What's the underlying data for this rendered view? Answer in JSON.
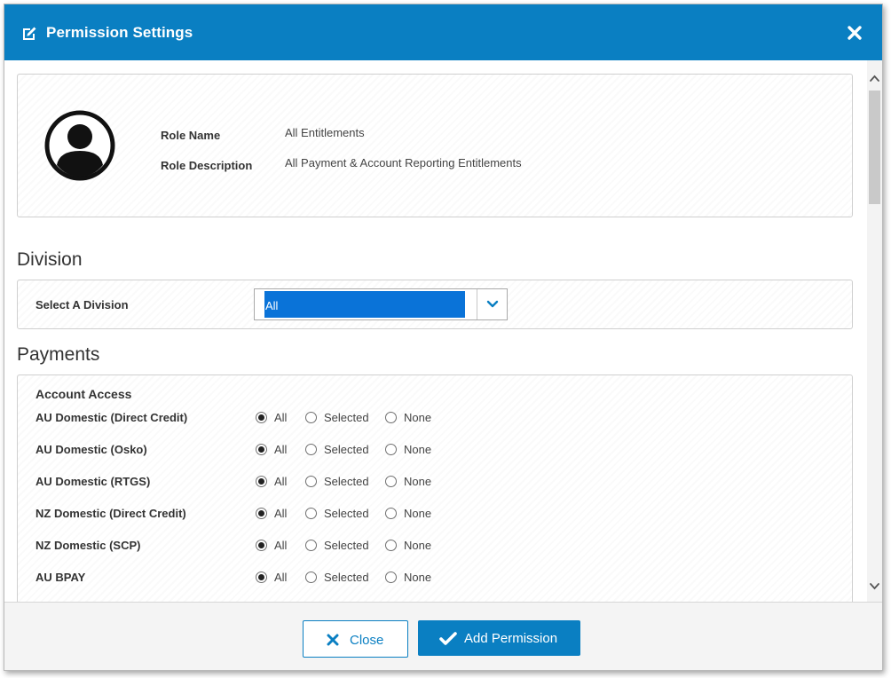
{
  "dialog": {
    "title": "Permission Settings",
    "title_icon": "edit-icon",
    "close_icon": "close-icon"
  },
  "role": {
    "avatar_icon": "user-avatar-icon",
    "name_label": "Role Name",
    "name_value": "All Entitlements",
    "description_label": "Role Description",
    "description_value": "All Payment & Account Reporting Entitlements"
  },
  "division": {
    "section_title": "Division",
    "select_label": "Select A Division",
    "selected_value": "All",
    "dropdown_icon": "chevron-down-icon"
  },
  "payments": {
    "section_title": "Payments",
    "group_title": "Account Access",
    "option_labels": [
      "All",
      "Selected",
      "None"
    ],
    "rows": [
      {
        "label": "AU Domestic (Direct Credit)",
        "selected": "All"
      },
      {
        "label": "AU Domestic (Osko)",
        "selected": "All"
      },
      {
        "label": "AU Domestic (RTGS)",
        "selected": "All"
      },
      {
        "label": "NZ Domestic (Direct Credit)",
        "selected": "All"
      },
      {
        "label": "NZ Domestic (SCP)",
        "selected": "All"
      },
      {
        "label": "AU BPAY",
        "selected": "All"
      }
    ]
  },
  "footer": {
    "close_label": "Close",
    "add_label": "Add Permission"
  },
  "colors": {
    "brand_blue": "#0a7fc2",
    "select_highlight": "#0a73d8"
  }
}
